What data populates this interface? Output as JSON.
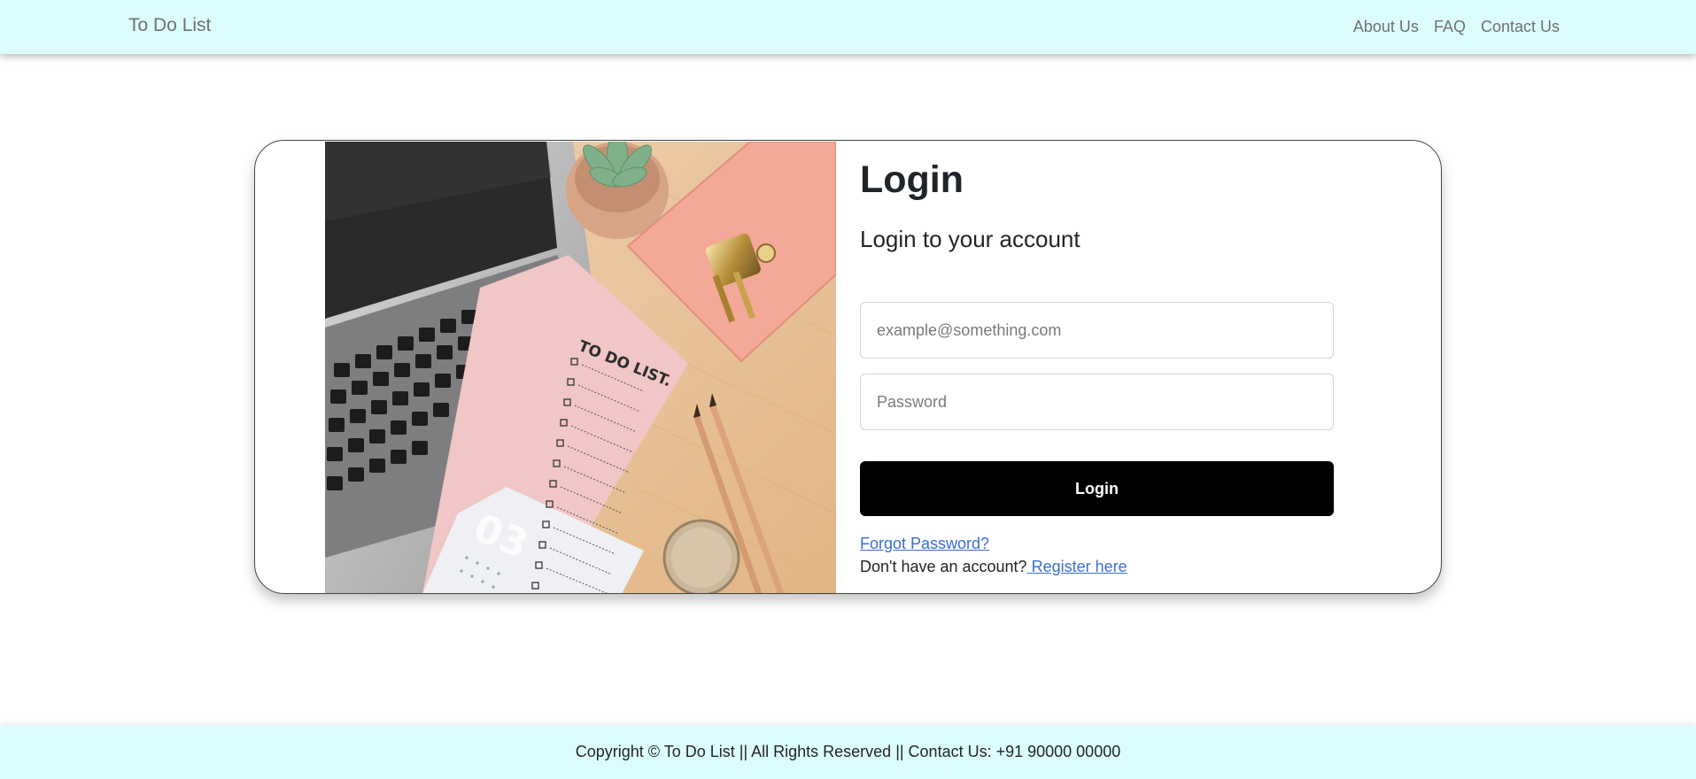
{
  "navbar": {
    "brand": "To Do List",
    "links": [
      "About Us",
      "FAQ",
      "Contact Us"
    ]
  },
  "hero": {
    "todo_heading": "TO DO LIST.",
    "month_number": "03"
  },
  "login": {
    "title": "Login",
    "subtitle": "Login to your account",
    "email_placeholder": "example@something.com",
    "password_placeholder": "Password",
    "button_label": "Login",
    "forgot_password": "Forgot Password?",
    "no_account_text": "Don't have an account?",
    "register_link": " Register here"
  },
  "footer": {
    "text": "Copyright © To Do List || All Rights Reserved || Contact Us: +91 90000 00000"
  },
  "colors": {
    "navbar_bg": "#dcfdfd",
    "button_bg": "#000000",
    "link": "#3b6fd0"
  }
}
